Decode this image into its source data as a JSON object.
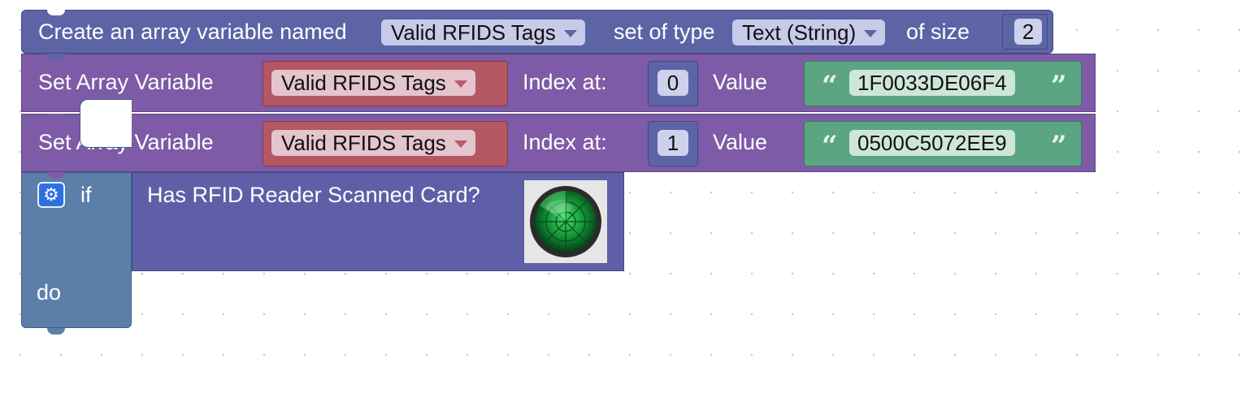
{
  "create_block": {
    "prefix": "Create an array variable named",
    "variable": "Valid RFIDS Tags",
    "set_of_type_label": "set of type",
    "type": "Text (String)",
    "of_size_label": "of size",
    "size": "2"
  },
  "set_blocks": [
    {
      "label": "Set Array Variable",
      "variable": "Valid RFIDS Tags",
      "index_label": "Index at:",
      "index": "0",
      "value_label": "Value",
      "value": "1F0033DE06F4"
    },
    {
      "label": "Set Array Variable",
      "variable": "Valid RFIDS Tags",
      "index_label": "Index at:",
      "index": "1",
      "value_label": "Value",
      "value": "0500C5072EE9"
    }
  ],
  "if_block": {
    "if_label": "if",
    "do_label": "do",
    "condition": "Has RFID Reader Scanned Card?"
  },
  "icons": {
    "settings": "gear-icon",
    "condition_image": "radar-icon",
    "open_quote": "open-quote-icon",
    "close_quote": "close-quote-icon"
  },
  "colors": {
    "create_block": "#5c64a6",
    "set_block": "#7d5ba6",
    "variable_socket": "#b35863",
    "text_socket": "#5ba582",
    "if_block": "#5b7fa8",
    "condition_block": "#5e5fa6"
  }
}
